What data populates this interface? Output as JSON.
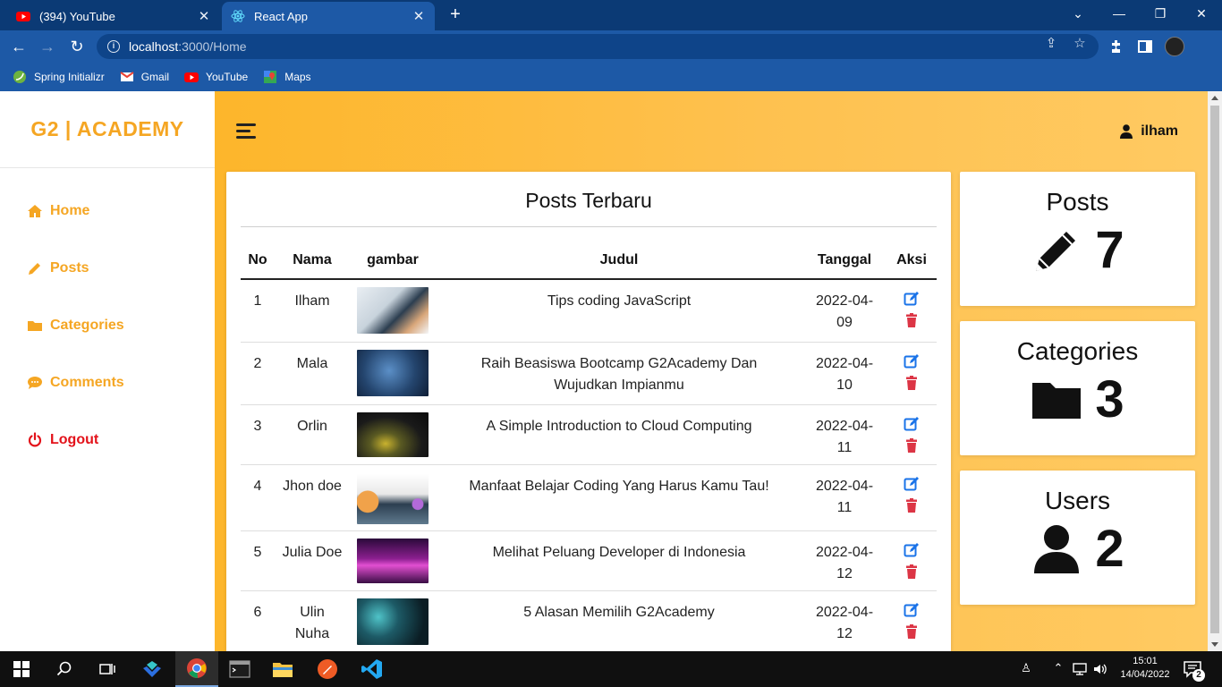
{
  "browser": {
    "tabs": [
      {
        "title": "(394) YouTube",
        "icon": "youtube-icon",
        "active": false
      },
      {
        "title": "React App",
        "icon": "react-icon",
        "active": true
      }
    ],
    "new_tab": "+",
    "url_host": "localhost",
    "url_path": ":3000/Home",
    "bookmarks": [
      {
        "label": "Spring Initializr",
        "icon": "spring-icon"
      },
      {
        "label": "Gmail",
        "icon": "gmail-icon"
      },
      {
        "label": "YouTube",
        "icon": "youtube-icon"
      },
      {
        "label": "Maps",
        "icon": "maps-icon"
      }
    ]
  },
  "app": {
    "brand": "G2 | ACADEMY",
    "menu": [
      {
        "label": "Home",
        "icon": "home-icon"
      },
      {
        "label": "Posts",
        "icon": "pencil-icon"
      },
      {
        "label": "Categories",
        "icon": "folder-icon"
      },
      {
        "label": "Comments",
        "icon": "comment-icon"
      },
      {
        "label": "Logout",
        "icon": "power-icon"
      }
    ],
    "user": "ilham",
    "posts_card": {
      "title": "Posts Terbaru",
      "columns": [
        "No",
        "Nama",
        "gambar",
        "Judul",
        "Tanggal",
        "Aksi"
      ],
      "rows": [
        {
          "no": "1",
          "nama": "Ilham",
          "judul": "Tips coding JavaScript",
          "tanggal": "2022-04-09"
        },
        {
          "no": "2",
          "nama": "Mala",
          "judul": "Raih Beasiswa Bootcamp G2Academy Dan Wujudkan Impianmu",
          "tanggal": "2022-04-10"
        },
        {
          "no": "3",
          "nama": "Orlin",
          "judul": "A Simple Introduction to Cloud Computing",
          "tanggal": "2022-04-11"
        },
        {
          "no": "4",
          "nama": "Jhon doe",
          "judul": "Manfaat Belajar Coding Yang Harus Kamu Tau!",
          "tanggal": "2022-04-11"
        },
        {
          "no": "5",
          "nama": "Julia Doe",
          "judul": "Melihat Peluang Developer di Indonesia",
          "tanggal": "2022-04-12"
        },
        {
          "no": "6",
          "nama": "Ulin Nuha",
          "judul": "5 Alasan Memilih G2Academy",
          "tanggal": "2022-04-12"
        }
      ]
    },
    "stats": [
      {
        "label": "Posts",
        "value": "7",
        "icon": "pencil-icon"
      },
      {
        "label": "Categories",
        "value": "3",
        "icon": "folder-icon"
      },
      {
        "label": "Users",
        "value": "2",
        "icon": "user-icon"
      }
    ]
  },
  "taskbar": {
    "time": "15:01",
    "date": "14/04/2022",
    "notifications": "2"
  },
  "colors": {
    "accent": "#f5a623",
    "logout": "#e3121a",
    "edit": "#1a73e8",
    "delete": "#dc3545"
  }
}
